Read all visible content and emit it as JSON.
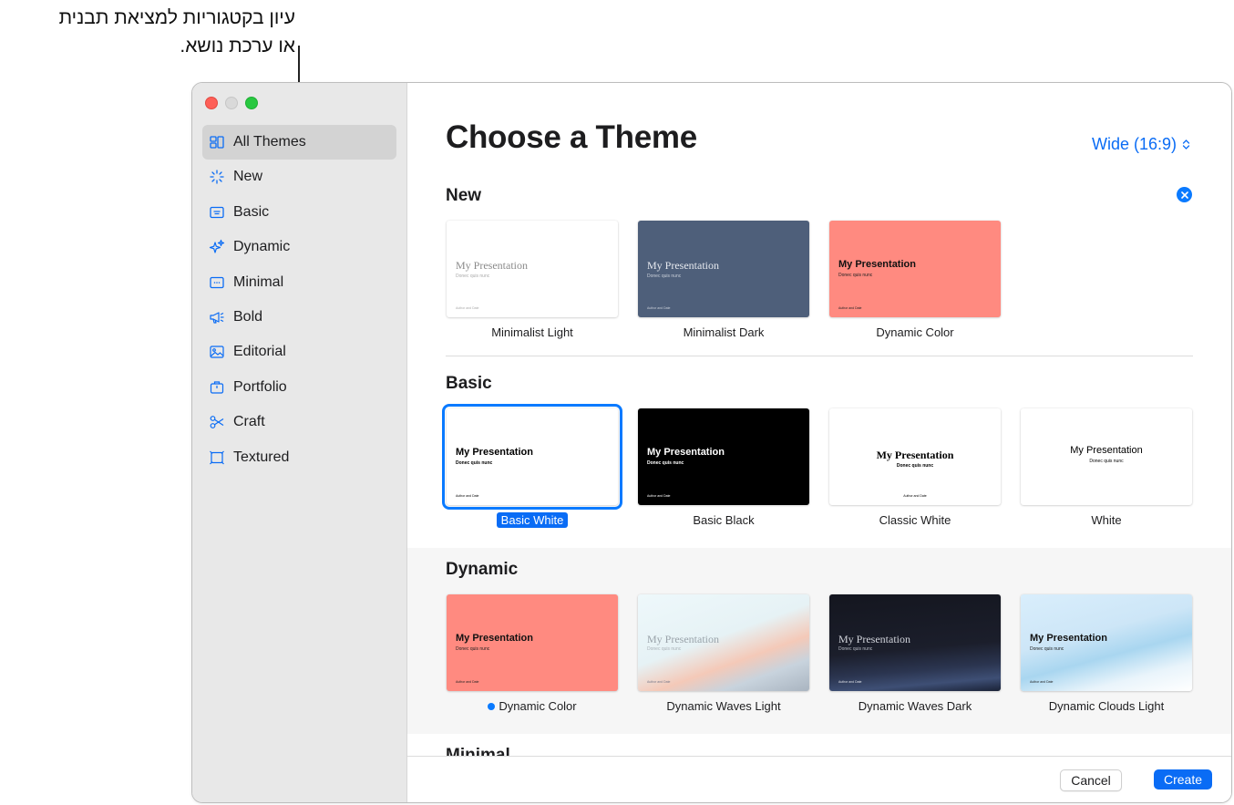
{
  "callout": {
    "line1": "עיון בקטגוריות למציאת תבנית",
    "line2": "או ערכת נושא."
  },
  "sidebar": {
    "items": [
      {
        "label": "All Themes",
        "icon": "grid-icon"
      },
      {
        "label": "New",
        "icon": "sparkle-icon"
      },
      {
        "label": "Basic",
        "icon": "slide-icon"
      },
      {
        "label": "Dynamic",
        "icon": "sparkles-icon"
      },
      {
        "label": "Minimal",
        "icon": "minimal-icon"
      },
      {
        "label": "Bold",
        "icon": "megaphone-icon"
      },
      {
        "label": "Editorial",
        "icon": "photo-icon"
      },
      {
        "label": "Portfolio",
        "icon": "briefcase-icon"
      },
      {
        "label": "Craft",
        "icon": "scissors-icon"
      },
      {
        "label": "Textured",
        "icon": "textured-icon"
      }
    ]
  },
  "header": {
    "title": "Choose a Theme",
    "aspect": "Wide (16:9)"
  },
  "sections": {
    "new": {
      "title": "New",
      "themes": [
        "Minimalist Light",
        "Minimalist Dark",
        "Dynamic Color"
      ]
    },
    "basic": {
      "title": "Basic",
      "themes": [
        "Basic White",
        "Basic Black",
        "Classic White",
        "White"
      ]
    },
    "dynamic": {
      "title": "Dynamic",
      "themes": [
        "Dynamic Color",
        "Dynamic Waves Light",
        "Dynamic Waves Dark",
        "Dynamic Clouds Light"
      ]
    },
    "minimal": {
      "title": "Minimal"
    }
  },
  "thumb": {
    "title": "My Presentation",
    "subtitle": "Donec quis nunc",
    "author": "Author and Date"
  },
  "footer": {
    "cancel": "Cancel",
    "create": "Create"
  },
  "colors": {
    "accent": "#0a6cf5",
    "sidebar_bg": "#e8e8e8",
    "coral": "#ff8a80",
    "slate": "#4e5f7a"
  }
}
